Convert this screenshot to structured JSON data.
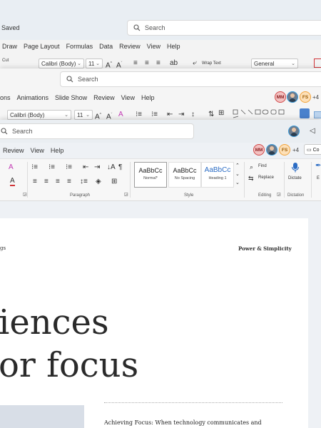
{
  "excel": {
    "status": "Saved",
    "search_placeholder": "Search",
    "menu": [
      "Draw",
      "Page Layout",
      "Formulas",
      "Data",
      "Review",
      "View",
      "Help"
    ],
    "cut_label": "Cut",
    "font_name": "Calibri (Body)",
    "font_size": "11",
    "wrap_text_label": "Wrap Text",
    "number_format": "General"
  },
  "ppt": {
    "search_placeholder": "Search",
    "menu": [
      "ons",
      "Animations",
      "Slide Show",
      "Review",
      "View",
      "Help"
    ],
    "font_name": "Calibri (Body)",
    "font_size": "11",
    "avatars": {
      "mm": "MM",
      "fs": "FS",
      "more": "+4"
    }
  },
  "word": {
    "search_placeholder": "Search",
    "menu": [
      "Review",
      "View",
      "Help"
    ],
    "avatars": {
      "mm": "MM",
      "fs": "FS",
      "more": "+4"
    },
    "comments_label": "Co",
    "groups": {
      "paragraph": "Paragraph",
      "style": "Style",
      "editing": "Editing",
      "dictation": "Dictation"
    },
    "styles": [
      {
        "sample": "AaBbCc",
        "name": "Normal*"
      },
      {
        "sample": "AaBbCc",
        "name": "No Spacing"
      },
      {
        "sample": "AaBbCc",
        "name": "Heading 1"
      }
    ],
    "find_label": "Find",
    "replace_label": "Replace",
    "dictate_label": "Dictate",
    "partial_label": "E"
  },
  "doc": {
    "header_left": "gs",
    "header_right": "Power & Simplicity",
    "title_line1": "iences",
    "title_line2": "or focus",
    "body_text": "Achieving Focus: When technology communicates and"
  },
  "colors": {
    "accent_blue": "#2b6cc4",
    "font_red": "#d13438",
    "highlight": "#ffe100"
  }
}
